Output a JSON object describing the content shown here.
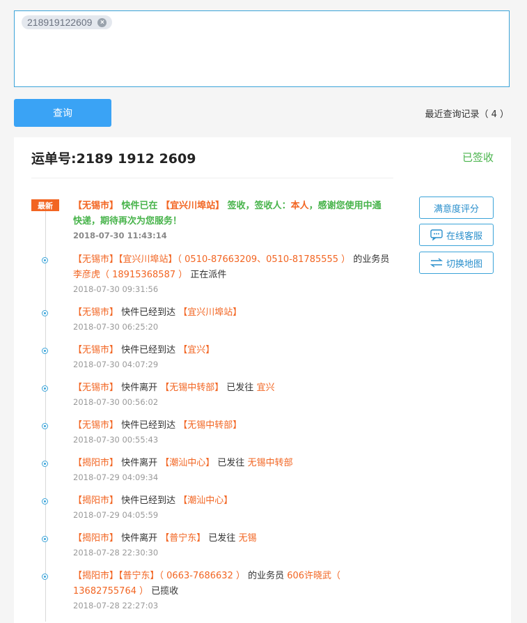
{
  "search": {
    "tag": "218919122609",
    "query_label": "查询",
    "recent_label": "最近查询记录（ 4 ）"
  },
  "result": {
    "waybill_label": "运单号:2189 1912 2609",
    "status": "已签收",
    "new_badge": "最新"
  },
  "side_buttons": {
    "rate": "满意度评分",
    "service": "在线客服",
    "map": "切换地图"
  },
  "events": [
    {
      "parts": [
        "【无锡市】",
        " 快件已在 ",
        "【宜兴川埠站】",
        " 签收，签收人：",
        "本人",
        "，感谢您使用中通快递，期待再次为您服务！"
      ],
      "time": "2018-07-30 11:43:14"
    },
    {
      "parts": [
        "【无锡市】",
        "【宜兴川埠站】",
        "（ 0510-87663209、0510-81785555 ）",
        " 的业务员 ",
        "李彦虎（ 18915368587 ）",
        " 正在派件"
      ],
      "time": "2018-07-30 09:31:56"
    },
    {
      "parts": [
        "【无锡市】",
        " 快件已经到达 ",
        "【宜兴川埠站】"
      ],
      "time": "2018-07-30 06:25:20"
    },
    {
      "parts": [
        "【无锡市】",
        " 快件已经到达 ",
        "【宜兴】"
      ],
      "time": "2018-07-30 04:07:29"
    },
    {
      "parts": [
        "【无锡市】",
        " 快件离开 ",
        "【无锡中转部】",
        " 已发往 ",
        "宜兴"
      ],
      "time": "2018-07-30 00:56:02"
    },
    {
      "parts": [
        "【无锡市】",
        " 快件已经到达 ",
        "【无锡中转部】"
      ],
      "time": "2018-07-30 00:55:43"
    },
    {
      "parts": [
        "【揭阳市】",
        " 快件离开 ",
        "【潮汕中心】",
        " 已发往 ",
        "无锡中转部"
      ],
      "time": "2018-07-29 04:09:34"
    },
    {
      "parts": [
        "【揭阳市】",
        " 快件已经到达 ",
        "【潮汕中心】"
      ],
      "time": "2018-07-29 04:05:59"
    },
    {
      "parts": [
        "【揭阳市】",
        " 快件离开 ",
        "【普宁东】",
        " 已发往 ",
        "无锡"
      ],
      "time": "2018-07-28 22:30:30"
    },
    {
      "parts": [
        "【揭阳市】",
        "【普宁东】",
        "（ 0663-7686632 ）",
        " 的业务员 ",
        "606许晓武（ 13682755764 ）",
        " 已揽收"
      ],
      "time": "2018-07-28 22:27:03"
    }
  ]
}
